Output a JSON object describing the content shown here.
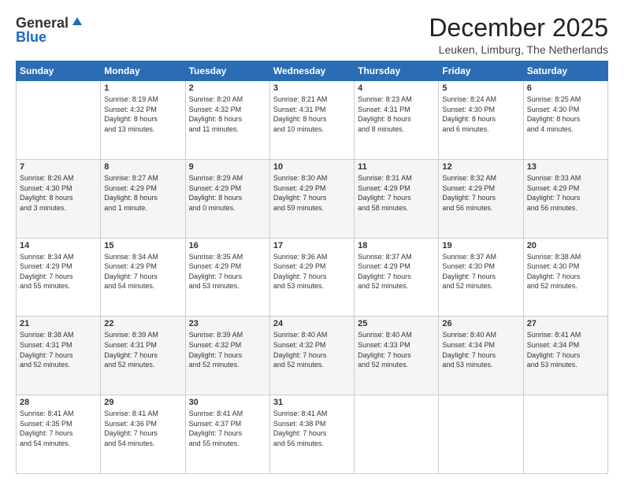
{
  "logo": {
    "general": "General",
    "blue": "Blue"
  },
  "title": "December 2025",
  "subtitle": "Leuken, Limburg, The Netherlands",
  "days_header": [
    "Sunday",
    "Monday",
    "Tuesday",
    "Wednesday",
    "Thursday",
    "Friday",
    "Saturday"
  ],
  "weeks": [
    [
      {
        "num": "",
        "info": ""
      },
      {
        "num": "1",
        "info": "Sunrise: 8:19 AM\nSunset: 4:32 PM\nDaylight: 8 hours\nand 13 minutes."
      },
      {
        "num": "2",
        "info": "Sunrise: 8:20 AM\nSunset: 4:32 PM\nDaylight: 8 hours\nand 11 minutes."
      },
      {
        "num": "3",
        "info": "Sunrise: 8:21 AM\nSunset: 4:31 PM\nDaylight: 8 hours\nand 10 minutes."
      },
      {
        "num": "4",
        "info": "Sunrise: 8:23 AM\nSunset: 4:31 PM\nDaylight: 8 hours\nand 8 minutes."
      },
      {
        "num": "5",
        "info": "Sunrise: 8:24 AM\nSunset: 4:30 PM\nDaylight: 8 hours\nand 6 minutes."
      },
      {
        "num": "6",
        "info": "Sunrise: 8:25 AM\nSunset: 4:30 PM\nDaylight: 8 hours\nand 4 minutes."
      }
    ],
    [
      {
        "num": "7",
        "info": "Sunrise: 8:26 AM\nSunset: 4:30 PM\nDaylight: 8 hours\nand 3 minutes."
      },
      {
        "num": "8",
        "info": "Sunrise: 8:27 AM\nSunset: 4:29 PM\nDaylight: 8 hours\nand 1 minute."
      },
      {
        "num": "9",
        "info": "Sunrise: 8:29 AM\nSunset: 4:29 PM\nDaylight: 8 hours\nand 0 minutes."
      },
      {
        "num": "10",
        "info": "Sunrise: 8:30 AM\nSunset: 4:29 PM\nDaylight: 7 hours\nand 59 minutes."
      },
      {
        "num": "11",
        "info": "Sunrise: 8:31 AM\nSunset: 4:29 PM\nDaylight: 7 hours\nand 58 minutes."
      },
      {
        "num": "12",
        "info": "Sunrise: 8:32 AM\nSunset: 4:29 PM\nDaylight: 7 hours\nand 56 minutes."
      },
      {
        "num": "13",
        "info": "Sunrise: 8:33 AM\nSunset: 4:29 PM\nDaylight: 7 hours\nand 56 minutes."
      }
    ],
    [
      {
        "num": "14",
        "info": "Sunrise: 8:34 AM\nSunset: 4:29 PM\nDaylight: 7 hours\nand 55 minutes."
      },
      {
        "num": "15",
        "info": "Sunrise: 8:34 AM\nSunset: 4:29 PM\nDaylight: 7 hours\nand 54 minutes."
      },
      {
        "num": "16",
        "info": "Sunrise: 8:35 AM\nSunset: 4:29 PM\nDaylight: 7 hours\nand 53 minutes."
      },
      {
        "num": "17",
        "info": "Sunrise: 8:36 AM\nSunset: 4:29 PM\nDaylight: 7 hours\nand 53 minutes."
      },
      {
        "num": "18",
        "info": "Sunrise: 8:37 AM\nSunset: 4:29 PM\nDaylight: 7 hours\nand 52 minutes."
      },
      {
        "num": "19",
        "info": "Sunrise: 8:37 AM\nSunset: 4:30 PM\nDaylight: 7 hours\nand 52 minutes."
      },
      {
        "num": "20",
        "info": "Sunrise: 8:38 AM\nSunset: 4:30 PM\nDaylight: 7 hours\nand 52 minutes."
      }
    ],
    [
      {
        "num": "21",
        "info": "Sunrise: 8:38 AM\nSunset: 4:31 PM\nDaylight: 7 hours\nand 52 minutes."
      },
      {
        "num": "22",
        "info": "Sunrise: 8:39 AM\nSunset: 4:31 PM\nDaylight: 7 hours\nand 52 minutes."
      },
      {
        "num": "23",
        "info": "Sunrise: 8:39 AM\nSunset: 4:32 PM\nDaylight: 7 hours\nand 52 minutes."
      },
      {
        "num": "24",
        "info": "Sunrise: 8:40 AM\nSunset: 4:32 PM\nDaylight: 7 hours\nand 52 minutes."
      },
      {
        "num": "25",
        "info": "Sunrise: 8:40 AM\nSunset: 4:33 PM\nDaylight: 7 hours\nand 52 minutes."
      },
      {
        "num": "26",
        "info": "Sunrise: 8:40 AM\nSunset: 4:34 PM\nDaylight: 7 hours\nand 53 minutes."
      },
      {
        "num": "27",
        "info": "Sunrise: 8:41 AM\nSunset: 4:34 PM\nDaylight: 7 hours\nand 53 minutes."
      }
    ],
    [
      {
        "num": "28",
        "info": "Sunrise: 8:41 AM\nSunset: 4:35 PM\nDaylight: 7 hours\nand 54 minutes."
      },
      {
        "num": "29",
        "info": "Sunrise: 8:41 AM\nSunset: 4:36 PM\nDaylight: 7 hours\nand 54 minutes."
      },
      {
        "num": "30",
        "info": "Sunrise: 8:41 AM\nSunset: 4:37 PM\nDaylight: 7 hours\nand 55 minutes."
      },
      {
        "num": "31",
        "info": "Sunrise: 8:41 AM\nSunset: 4:38 PM\nDaylight: 7 hours\nand 56 minutes."
      },
      {
        "num": "",
        "info": ""
      },
      {
        "num": "",
        "info": ""
      },
      {
        "num": "",
        "info": ""
      }
    ]
  ]
}
